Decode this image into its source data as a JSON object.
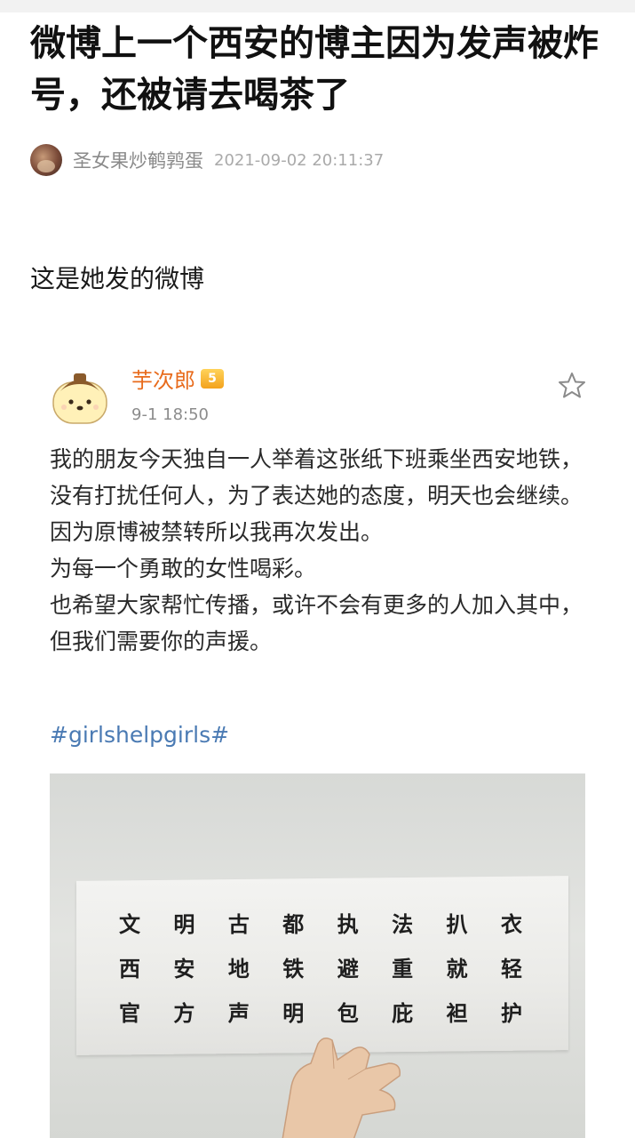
{
  "article": {
    "title": "微博上一个西安的博主因为发声被炸号，还被请去喝茶了",
    "author": "圣女果炒鹌鹑蛋",
    "datetime": "2021-09-02 20:11:37",
    "intro": "这是她发的微博"
  },
  "weibo": {
    "username": "芋次郎",
    "vip_level": "5",
    "time": "9-1 18:50",
    "paragraphs": [
      "我的朋友今天独自一人举着这张纸下班乘坐西安地铁，没有打扰任何人，为了表达她的态度，明天也会继续。因为原博被禁转所以我再次发出。",
      "为每一个勇敢的女性喝彩。",
      "也希望大家帮忙传播，或许不会有更多的人加入其中，但我们需要你的声援。"
    ],
    "hashtag": "#girlshelpgirls#"
  },
  "sign": {
    "rows": [
      [
        "文",
        "明",
        "古",
        "都",
        "执",
        "法",
        "扒",
        "衣"
      ],
      [
        "西",
        "安",
        "地",
        "铁",
        "避",
        "重",
        "就",
        "轻"
      ],
      [
        "官",
        "方",
        "声",
        "明",
        "包",
        "庇",
        "袒",
        "护"
      ]
    ]
  },
  "colors": {
    "username": "#e86b1c",
    "hashtag": "#4a7ab3",
    "meta": "#8c8c8c"
  },
  "icons": {
    "favorite": "star-outline-icon",
    "vip": "vip-crown-badge-icon"
  }
}
